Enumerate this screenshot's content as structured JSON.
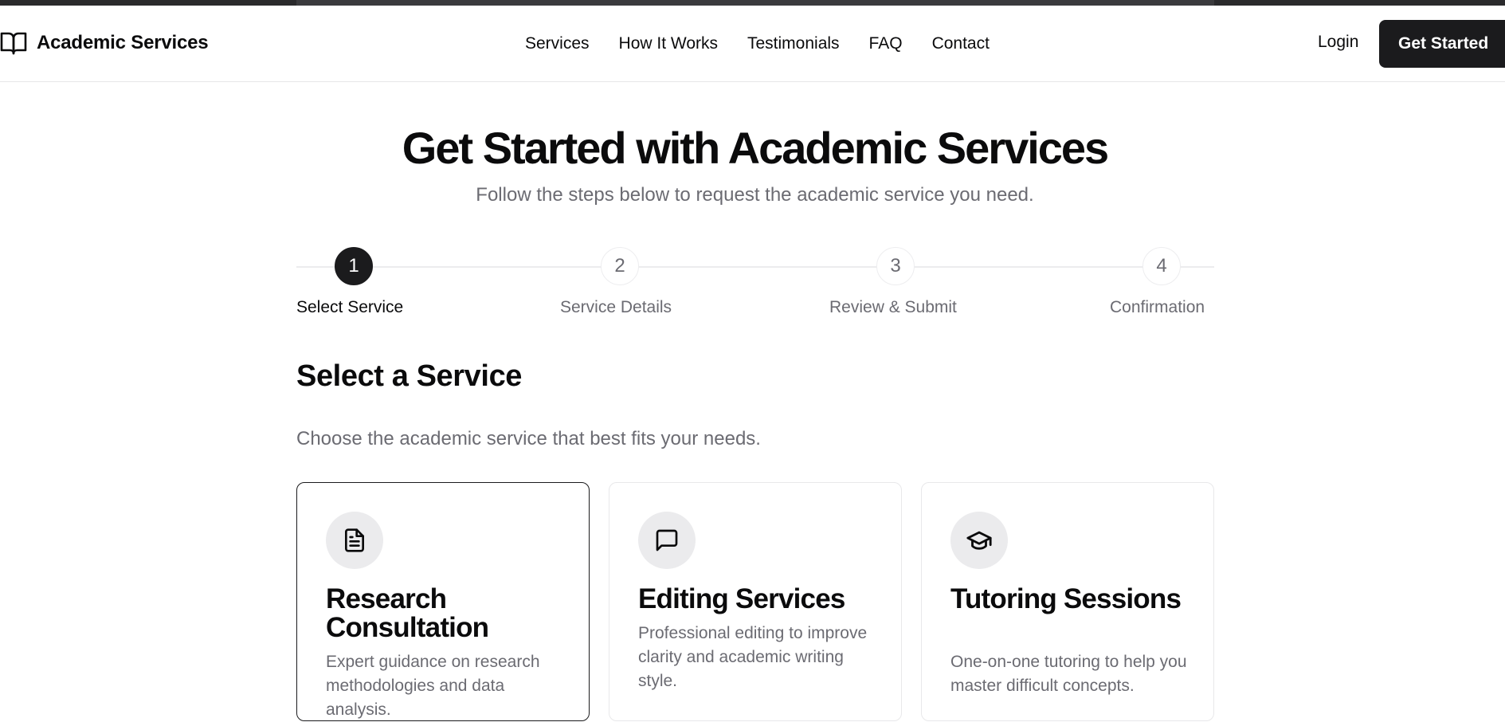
{
  "header": {
    "brand": {
      "name": "Academic Services",
      "icon": "book-open-icon"
    },
    "nav": [
      "Services",
      "How It Works",
      "Testimonials",
      "FAQ",
      "Contact"
    ],
    "login_label": "Login",
    "cta_label": "Get Started"
  },
  "hero": {
    "title": "Get Started with Academic Services",
    "subtitle": "Follow the steps below to request the academic service you need."
  },
  "stepper": {
    "current_step": 1,
    "steps": [
      {
        "number": "1",
        "label": "Select Service"
      },
      {
        "number": "2",
        "label": "Service Details"
      },
      {
        "number": "3",
        "label": "Review & Submit"
      },
      {
        "number": "4",
        "label": "Confirmation"
      }
    ]
  },
  "section": {
    "title": "Select a Service",
    "description": "Choose the academic service that best fits your needs."
  },
  "services": [
    {
      "title": "Research Consultation",
      "description": "Expert guidance on research methodologies and data analysis.",
      "icon": "file-text-icon",
      "selected": true
    },
    {
      "title": "Editing Services",
      "description": "Professional editing to improve clarity and academic writing style.",
      "icon": "message-square-icon",
      "selected": false
    },
    {
      "title": "Tutoring Sessions",
      "description": "One-on-one tutoring to help you master difficult concepts.",
      "icon": "graduation-cap-icon",
      "selected": false
    }
  ],
  "colors": {
    "primary": "#1b1b1d",
    "text": "#0b0b0c",
    "muted_text": "#6b6b72",
    "border": "#e8e8ea",
    "icon_background": "#ebebed"
  }
}
